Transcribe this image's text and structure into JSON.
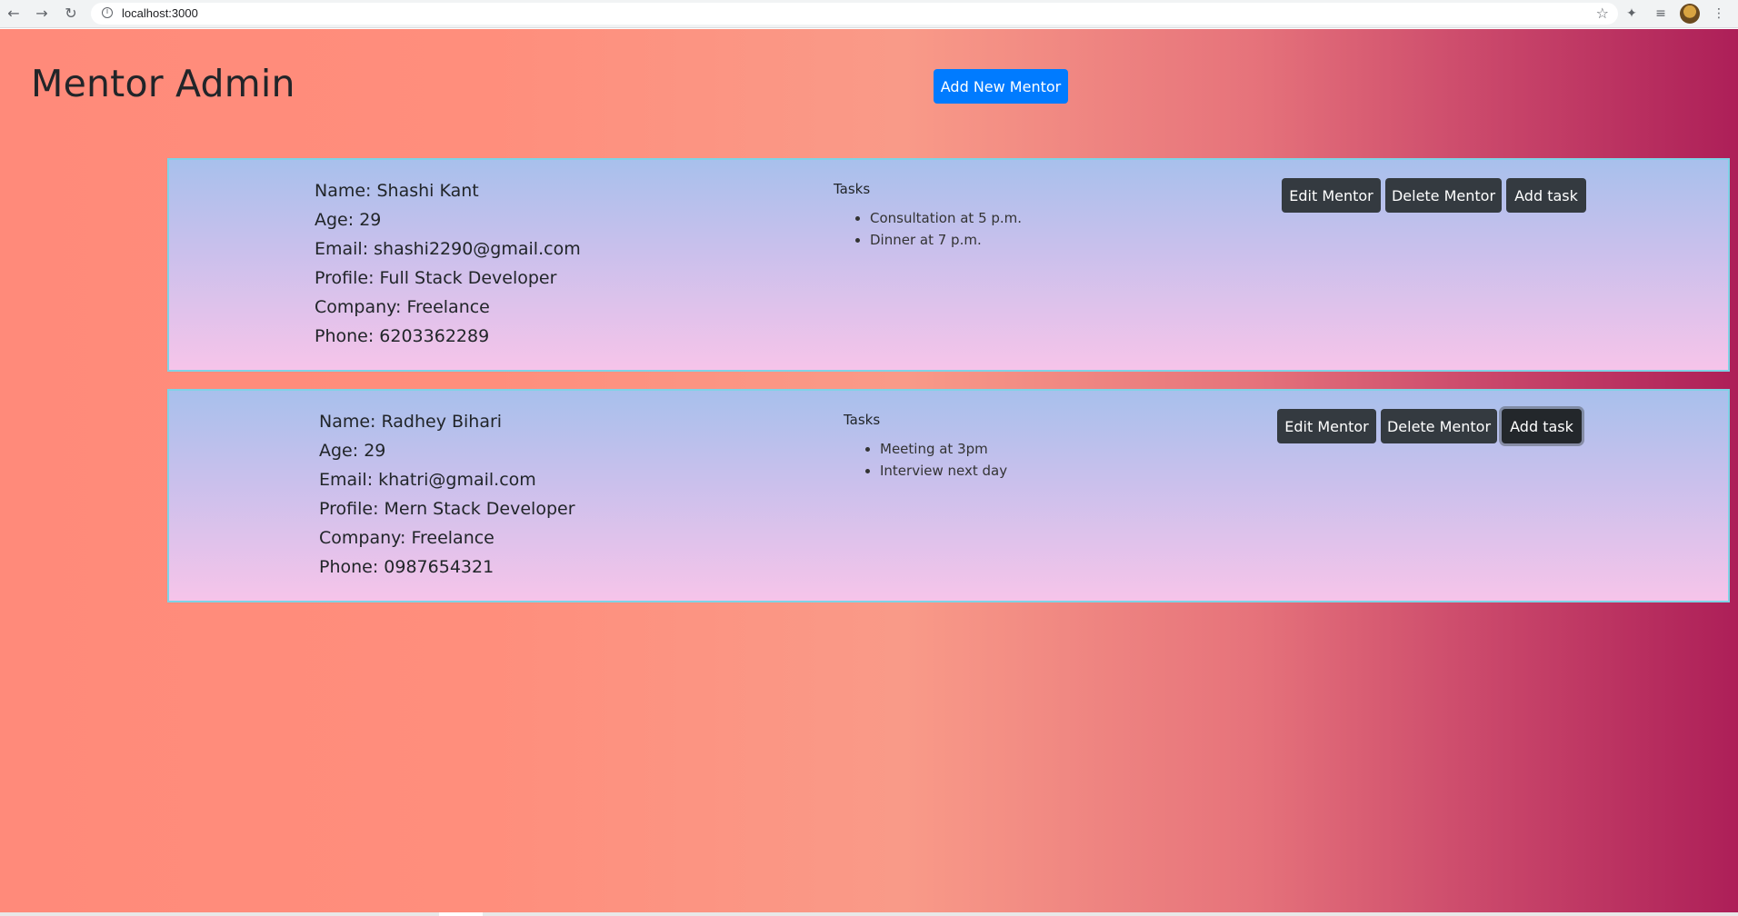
{
  "browser": {
    "url": "localhost:3000"
  },
  "header": {
    "title": "Mentor Admin",
    "add_button_label": "Add New Mentor"
  },
  "mentors": [
    {
      "name": "Name: Shashi Kant",
      "age": "Age: 29",
      "email": "Email: shashi2290@gmail.com",
      "profile": "Profile: Full Stack Developer",
      "company": "Company: Freelance",
      "phone": "Phone: 6203362289",
      "tasks_heading": "Tasks",
      "tasks": [
        "Consultation at 5 p.m.",
        "Dinner at 7 p.m."
      ],
      "edit_label": "Edit Mentor",
      "delete_label": "Delete Mentor",
      "add_task_label": "Add task"
    },
    {
      "name": "Name: Radhey Bihari",
      "age": "Age: 29",
      "email": "Email: khatri@gmail.com",
      "profile": "Profile: Mern Stack Developer",
      "company": "Company: Freelance",
      "phone": "Phone: 0987654321",
      "tasks_heading": "Tasks",
      "tasks": [
        "Meeting at 3pm",
        "Interview next day"
      ],
      "edit_label": "Edit Mentor",
      "delete_label": "Delete Mentor",
      "add_task_label": "Add task"
    }
  ],
  "colors": {
    "primary": "#007bff",
    "dark": "#343a40",
    "card_border": "#7ed3e6"
  },
  "icons": [
    "back-arrow-icon",
    "forward-arrow-icon",
    "reload-icon",
    "info-icon",
    "star-icon",
    "extensions-icon",
    "reading-list-icon",
    "avatar",
    "more-menu-icon"
  ]
}
